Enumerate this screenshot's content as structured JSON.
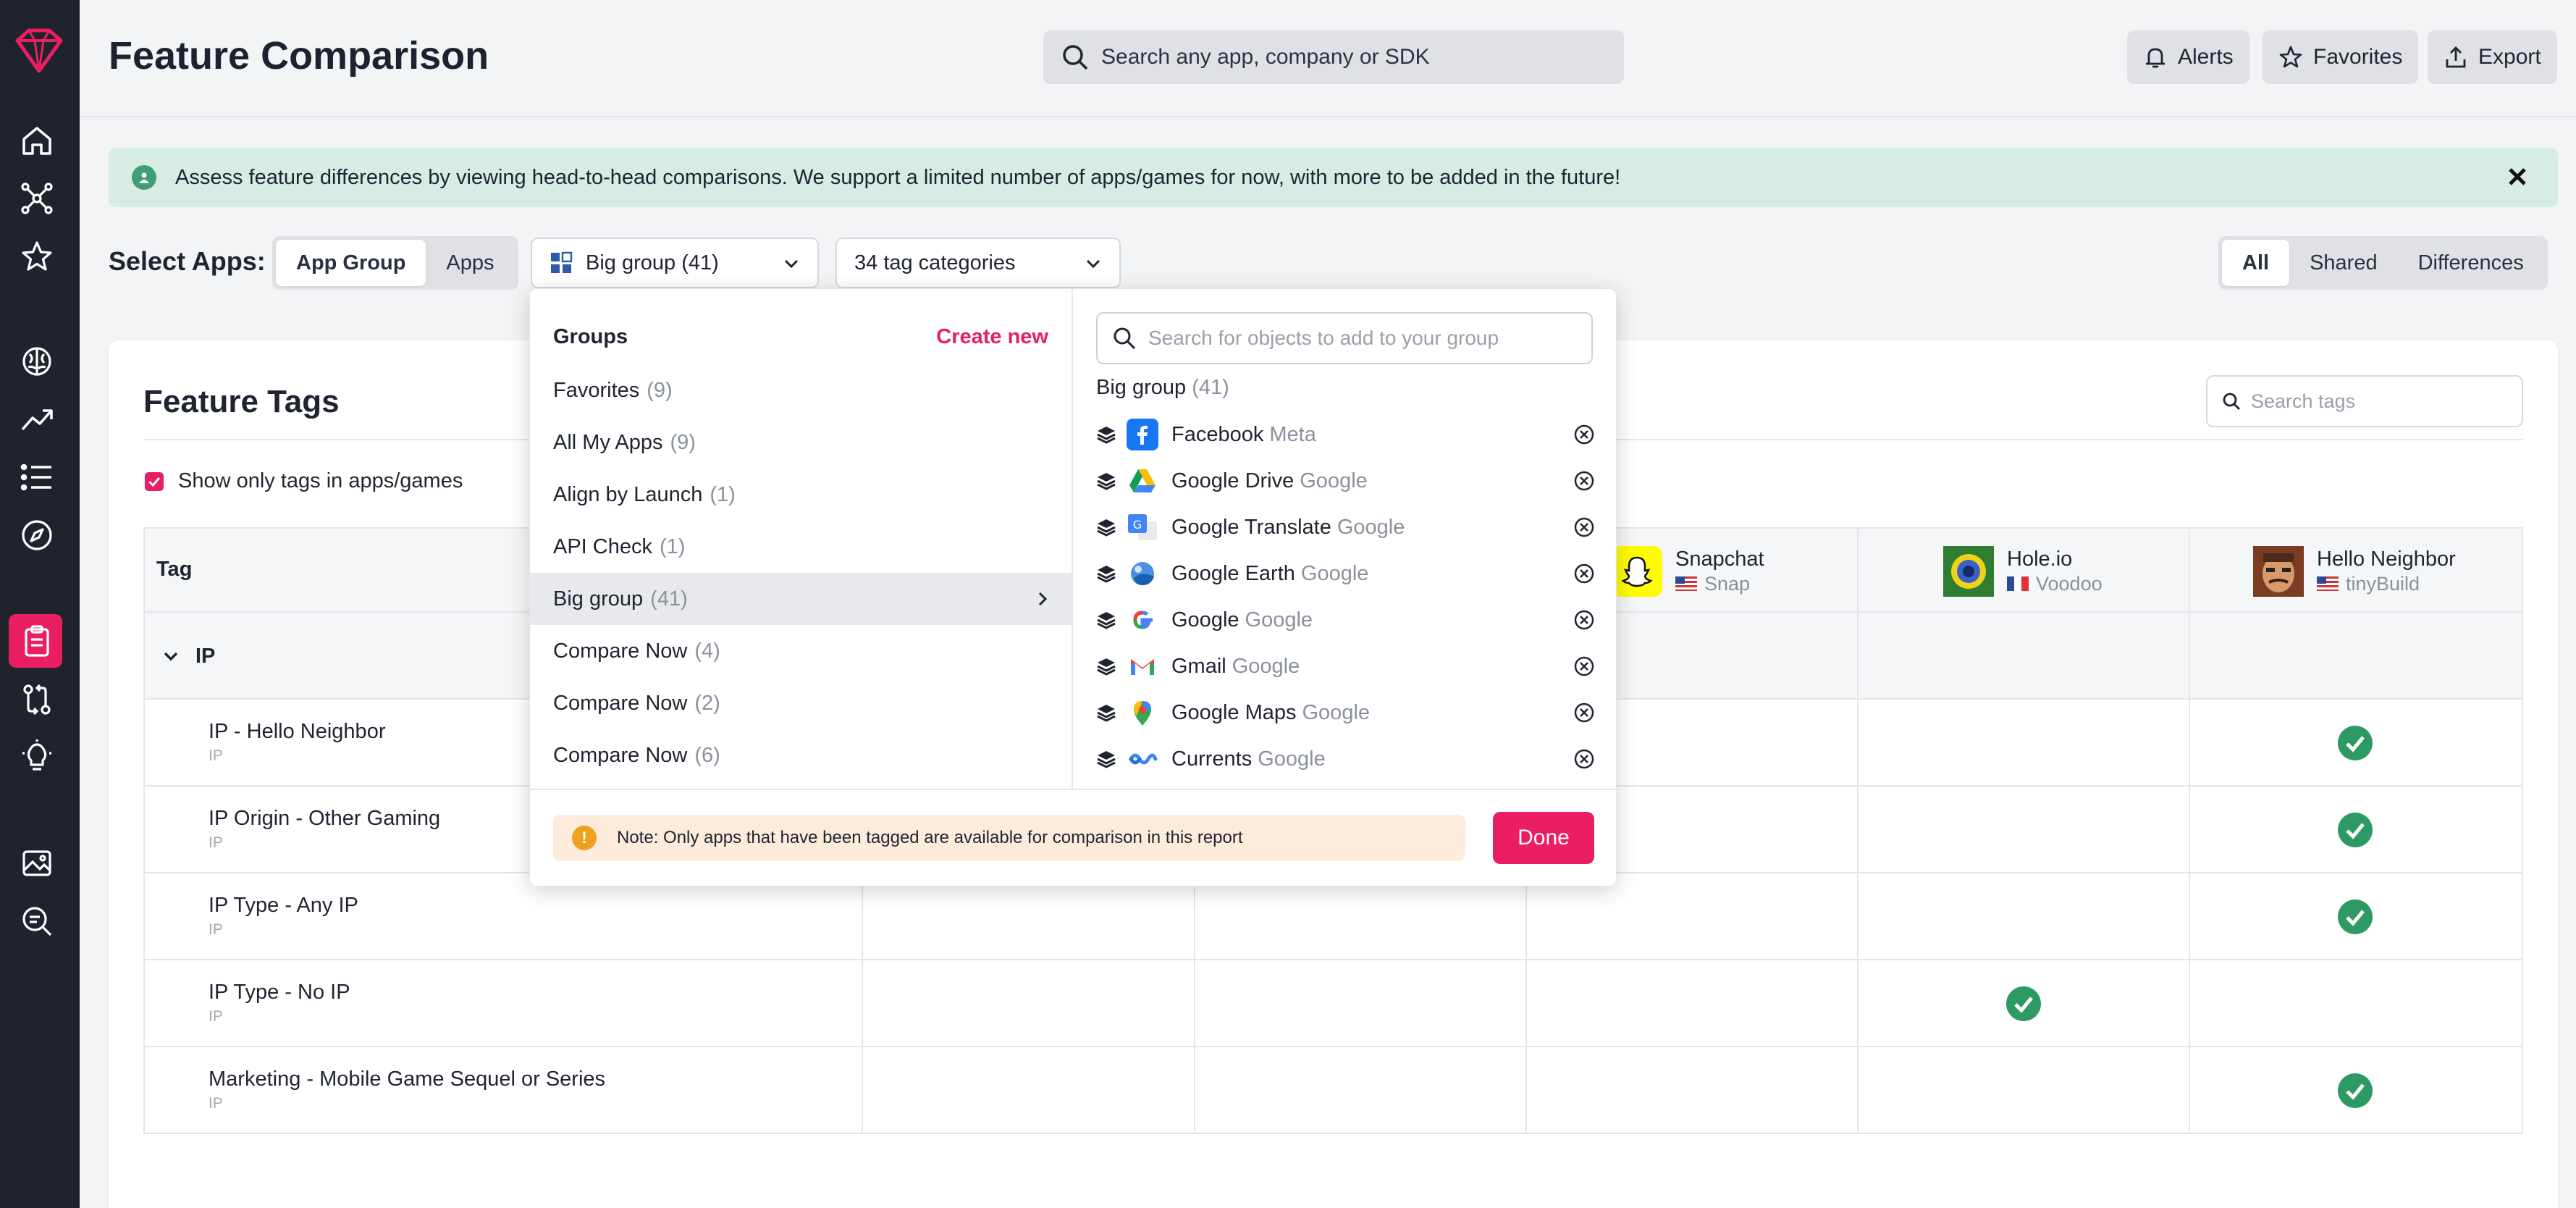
{
  "header": {
    "title": "Feature Comparison",
    "search_placeholder": "Search any app, company or SDK",
    "buttons": {
      "alerts": "Alerts",
      "favorites": "Favorites",
      "export": "Export"
    }
  },
  "banner": {
    "text": "Assess feature differences by viewing head-to-head comparisons. We support a limited number of apps/games for now, with more to be added in the future!"
  },
  "controls": {
    "select_label": "Select Apps:",
    "app_toggle": [
      "App Group",
      "Apps"
    ],
    "app_toggle_selected": "App Group",
    "group_dropdown": "Big group (41)",
    "tag_dropdown": "34 tag categories",
    "view_toggle": [
      "All",
      "Shared",
      "Differences"
    ],
    "view_toggle_selected": "All"
  },
  "card": {
    "title": "Feature Tags",
    "tag_search_placeholder": "Search tags",
    "show_only_label": "Show only tags in apps/games",
    "show_only_checked": true
  },
  "table": {
    "tag_header": "Tag",
    "columns": [
      {
        "name": "Snapchat",
        "publisher": "Snap",
        "country": "US"
      },
      {
        "name": "Hole.io",
        "publisher": "Voodoo",
        "country": "FR"
      },
      {
        "name": "Hello Neighbor",
        "publisher": "tinyBuild",
        "country": "US"
      }
    ],
    "group": "IP",
    "rows": [
      {
        "name": "IP - Hello Neighbor",
        "category": "IP",
        "checks": [
          "Hello Neighbor"
        ]
      },
      {
        "name": "IP Origin - Other Gaming",
        "category": "IP",
        "checks": [
          "Hello Neighbor"
        ]
      },
      {
        "name": "IP Type - Any IP",
        "category": "IP",
        "checks": [
          "Hello Neighbor"
        ]
      },
      {
        "name": "IP Type - No IP",
        "category": "IP",
        "checks": [
          "Hole.io"
        ]
      },
      {
        "name": "Marketing - Mobile Game Sequel or Series",
        "category": "IP",
        "checks": [
          "Hello Neighbor"
        ]
      }
    ]
  },
  "popover": {
    "groups_heading": "Groups",
    "create_new": "Create new",
    "groups": [
      {
        "name": "Favorites",
        "count": "(9)"
      },
      {
        "name": "All My Apps",
        "count": "(9)"
      },
      {
        "name": "Align by Launch",
        "count": "(1)"
      },
      {
        "name": "API Check",
        "count": "(1)"
      },
      {
        "name": "Big group",
        "count": "(41)",
        "selected": true
      },
      {
        "name": "Compare Now",
        "count": "(4)"
      },
      {
        "name": "Compare Now",
        "count": "(2)"
      },
      {
        "name": "Compare Now",
        "count": "(6)"
      }
    ],
    "object_search_placeholder": "Search for objects to add to your group",
    "selected_group_name": "Big group",
    "selected_group_count": "(41)",
    "members": [
      {
        "name": "Facebook",
        "publisher": "Meta",
        "icon": "facebook-icon"
      },
      {
        "name": "Google Drive",
        "publisher": "Google",
        "icon": "google-drive-icon"
      },
      {
        "name": "Google Translate",
        "publisher": "Google",
        "icon": "google-translate-icon"
      },
      {
        "name": "Google Earth",
        "publisher": "Google",
        "icon": "google-earth-icon"
      },
      {
        "name": "Google",
        "publisher": "Google",
        "icon": "google-icon"
      },
      {
        "name": "Gmail",
        "publisher": "Google",
        "icon": "gmail-icon"
      },
      {
        "name": "Google Maps",
        "publisher": "Google",
        "icon": "google-maps-icon"
      },
      {
        "name": "Currents",
        "publisher": "Google",
        "icon": "currents-icon"
      }
    ],
    "note": "Note: Only apps that have been tagged are available for comparison in this report",
    "done": "Done"
  },
  "colors": {
    "accent": "#e91e63",
    "check_green": "#2e9a63",
    "banner_bg": "#d6ece4",
    "sidebar_bg": "#1f232b"
  }
}
